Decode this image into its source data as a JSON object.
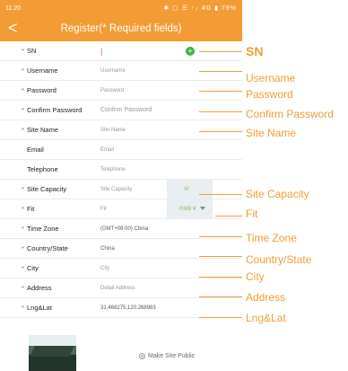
{
  "status": {
    "time": "11:20",
    "icons": "✱ ▢ ☰ ↑↓ 4G ▮ 79%"
  },
  "header": {
    "title": "Register(* Required fields)",
    "back": "<"
  },
  "fields": [
    {
      "key": "sn",
      "required": true,
      "label": "SN",
      "value": "|"
    },
    {
      "key": "username",
      "required": true,
      "label": "Username",
      "value": "Username"
    },
    {
      "key": "password",
      "required": true,
      "label": "Password",
      "value": "Password"
    },
    {
      "key": "confirm",
      "required": true,
      "label": "Confirm Password",
      "value": "Confirm Password"
    },
    {
      "key": "sitename",
      "required": true,
      "label": "Site Name",
      "value": "Site Name"
    },
    {
      "key": "email",
      "required": false,
      "label": "Email",
      "value": "Email"
    },
    {
      "key": "telephone",
      "required": false,
      "label": "Telephone",
      "value": "Telephone"
    },
    {
      "key": "capacity",
      "required": true,
      "label": "Site Capacity",
      "value": "Site Capacity",
      "unit": "W"
    },
    {
      "key": "fit",
      "required": true,
      "label": "Fit",
      "value": "Fit",
      "unit": "RMB ¥"
    },
    {
      "key": "timezone",
      "required": true,
      "label": "Time Zone",
      "value": "(GMT+08:00) China"
    },
    {
      "key": "country",
      "required": true,
      "label": "Country/State",
      "value": "China"
    },
    {
      "key": "city",
      "required": true,
      "label": "City",
      "value": "City"
    },
    {
      "key": "address",
      "required": true,
      "label": "Address",
      "value": "Detail Address"
    },
    {
      "key": "lnglat",
      "required": true,
      "label": "Lng&Lat",
      "value": "31.468275,120.268983"
    }
  ],
  "star": "*",
  "add_symbol": "+",
  "public_label": "Make Site Public",
  "annotations": {
    "sn": "SN",
    "username": "Username",
    "password": "Password",
    "confirm": "Confirm Password",
    "sitename": "Site Name",
    "capacity": "Site Capacity",
    "fit": "Fit",
    "timezone": "Time Zone",
    "country": "Country/State",
    "city": "City",
    "address": "Address",
    "lnglat": "Lng&Lat"
  },
  "colors": {
    "accent": "#f39c36",
    "required": "#e64b3b",
    "add": "#3db54a",
    "unit": "#8dc63f"
  }
}
